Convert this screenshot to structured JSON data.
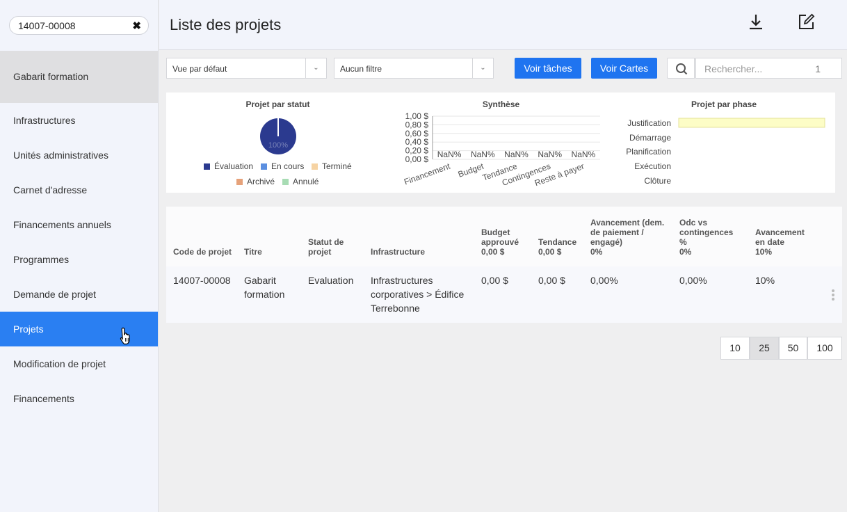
{
  "sidebar": {
    "search_value": "14007-00008",
    "group_label": "Gabarit formation",
    "items": [
      {
        "label": "Infrastructures"
      },
      {
        "label": "Unités administratives"
      },
      {
        "label": "Carnet d'adresse"
      },
      {
        "label": "Financements annuels"
      },
      {
        "label": "Programmes"
      },
      {
        "label": "Demande de projet"
      },
      {
        "label": "Projets",
        "active": true
      },
      {
        "label": "Modification de projet"
      },
      {
        "label": "Financements"
      }
    ]
  },
  "header": {
    "title": "Liste des projets",
    "icons": [
      "download-icon",
      "edit-icon"
    ]
  },
  "toolbar": {
    "view_select": "Vue par défaut",
    "filter_select": "Aucun filtre",
    "tasks_button": "Voir tâches",
    "cards_button": "Voir Cartes",
    "search_placeholder": "Rechercher...",
    "search_count": "1"
  },
  "colors": {
    "accent": "#1f74f0",
    "active_nav": "#2a7ff2",
    "evaluation": "#2b3a8f",
    "en_cours": "#5b8fe0",
    "termine": "#f6d3a3",
    "archive": "#e6a27a",
    "annule": "#a8dcb4",
    "phase_bar": "#fdfdc6"
  },
  "chart_data": [
    {
      "type": "pie",
      "title": "Projet par statut",
      "labels": [
        "Évaluation",
        "En cours",
        "Terminé",
        "Archivé",
        "Annulé"
      ],
      "values": [
        100,
        0,
        0,
        0,
        0
      ],
      "slice_label": "100%",
      "legend": "bottom"
    },
    {
      "type": "bar",
      "title": "Synthèse",
      "categories": [
        "Financement",
        "Budget",
        "Tendance",
        "Contingences",
        "Reste à payer"
      ],
      "values": [
        0,
        0,
        0,
        0,
        0
      ],
      "data_labels": [
        "NaN%",
        "NaN%",
        "NaN%",
        "NaN%",
        "NaN%"
      ],
      "yticks": [
        "0,00 $",
        "0,20 $",
        "0,40 $",
        "0,60 $",
        "0,80 $",
        "1,00 $"
      ],
      "ylim": [
        0,
        1
      ],
      "grid": true
    },
    {
      "type": "bar",
      "orientation": "horizontal",
      "title": "Projet par phase",
      "categories": [
        "Justification",
        "Démarrage",
        "Planification",
        "Exécution",
        "Clôture"
      ],
      "values": [
        1,
        0,
        0,
        0,
        0
      ]
    }
  ],
  "table": {
    "columns": [
      {
        "line1": "Code de projet"
      },
      {
        "line1": "Titre"
      },
      {
        "line1": "Statut de",
        "line2": "projet"
      },
      {
        "line1": "Infrastructure"
      },
      {
        "line1": "Budget",
        "line2": "approuvé",
        "line3": "0,00 $"
      },
      {
        "line1": "Tendance",
        "line2": "0,00 $"
      },
      {
        "line1": "Avancement (dem.",
        "line2": "de paiement /",
        "line3": "engagé)",
        "line4": "0%"
      },
      {
        "line1": "Odc vs",
        "line2": "contingences",
        "line3": "%",
        "line4": "0%"
      },
      {
        "line1": "Avancement",
        "line2": "en date",
        "line3": "10%"
      }
    ],
    "row": {
      "code": "14007-00008",
      "titre_1": "Gabarit",
      "titre_2": "formation",
      "statut": "Evaluation",
      "infra_1": "Infrastructures",
      "infra_2": "corporatives > Édifice",
      "infra_3": "Terrebonne",
      "budget": "0,00 $",
      "tendance": "0,00 $",
      "avancement": "0,00%",
      "odc": "0,00%",
      "avancement_date": "10%"
    }
  },
  "pagination": [
    "10",
    "25",
    "50",
    "100"
  ],
  "pagination_selected": "25"
}
